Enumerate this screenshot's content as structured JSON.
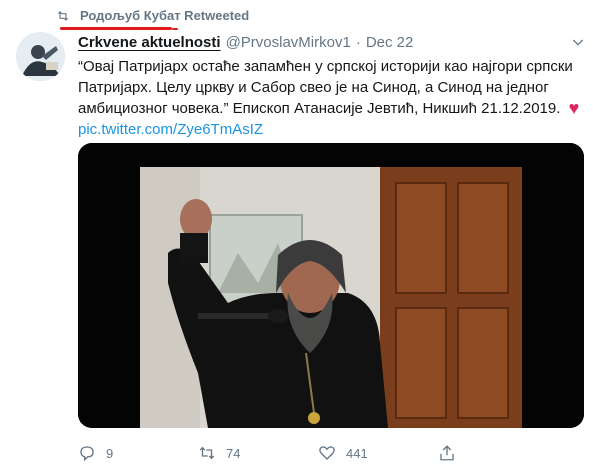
{
  "retweet": {
    "label": "Родољуб Кубат Retweeted"
  },
  "tweet": {
    "author_name": "Crkvene aktuelnosti",
    "author_handle": "@PrvoslavMirkov1",
    "separator": "·",
    "date": "Dec 22",
    "text": "“Овај Патријарх остаће запамћен у српској историји као најгори српски Патријарх. Целу цркву и Сабор свео је на Синод, а Синод на једног амбициозног човека.” Епископ Атанасије Јевтић, Никшић 21.12.2019.",
    "link": "pic.twitter.com/Zye6TmAsIZ"
  },
  "actions": {
    "reply_count": "9",
    "retweet_count": "74",
    "like_count": "441"
  },
  "colors": {
    "accent": "#1b95e0",
    "heart": "#e0245e",
    "highlight_underline": "#e0191a"
  }
}
